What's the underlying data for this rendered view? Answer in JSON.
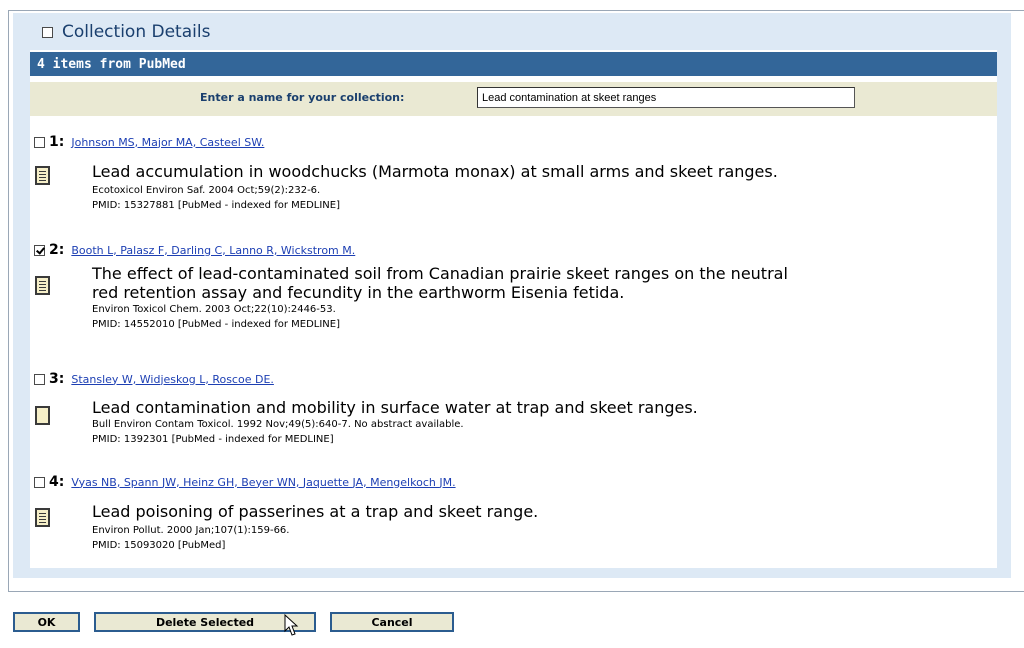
{
  "collection": {
    "header_label": "Collection Details",
    "source_label": "4 items from PubMed",
    "name_prompt": "Enter a name for your collection:",
    "name_value": "Lead contamination at skeet ranges"
  },
  "items": [
    {
      "number": "1:",
      "checked": false,
      "authors": "Johnson MS, Major MA, Casteel SW.",
      "title": "Lead accumulation in woodchucks (Marmota monax) at small arms and skeet ranges.",
      "citation": "Ecotoxicol Environ Saf. 2004 Oct;59(2):232-6.",
      "pmid": "PMID: 15327881 [PubMed - indexed for MEDLINE]",
      "icon": "abstract-document-icon"
    },
    {
      "number": "2:",
      "checked": true,
      "authors": "Booth L, Palasz F, Darling C, Lanno R, Wickstrom M.",
      "title_line1": "The effect of lead-contaminated soil from Canadian prairie skeet ranges on the neutral",
      "title_line2": "red retention assay and fecundity in the earthworm Eisenia fetida.",
      "citation": "Environ Toxicol Chem. 2003 Oct;22(10):2446-53.",
      "pmid": "PMID: 14552010 [PubMed - indexed for MEDLINE]",
      "icon": "abstract-document-icon"
    },
    {
      "number": "3:",
      "checked": false,
      "authors": "Stansley W, Widjeskog L, Roscoe DE.",
      "title": "Lead contamination and mobility in surface water at trap and skeet ranges.",
      "citation": "Bull Environ Contam Toxicol. 1992 Nov;49(5):640-7. No abstract available.",
      "pmid": "PMID: 1392301 [PubMed - indexed for MEDLINE]",
      "icon": "no-abstract-document-icon"
    },
    {
      "number": "4:",
      "checked": false,
      "authors": "Vyas NB, Spann JW, Heinz GH, Beyer WN, Jaquette JA, Mengelkoch JM.",
      "title": "Lead poisoning of passerines at a trap and skeet range.",
      "citation": "Environ Pollut. 2000 Jan;107(1):159-66.",
      "pmid": "PMID: 15093020 [PubMed]",
      "icon": "abstract-document-icon"
    }
  ],
  "buttons": {
    "ok": "OK",
    "delete_selected": "Delete Selected",
    "cancel": "Cancel"
  },
  "colors": {
    "source_bar": "#336699",
    "name_bar": "#eae9d3",
    "link": "#1d3fb3",
    "panel": "#dde9f5"
  }
}
